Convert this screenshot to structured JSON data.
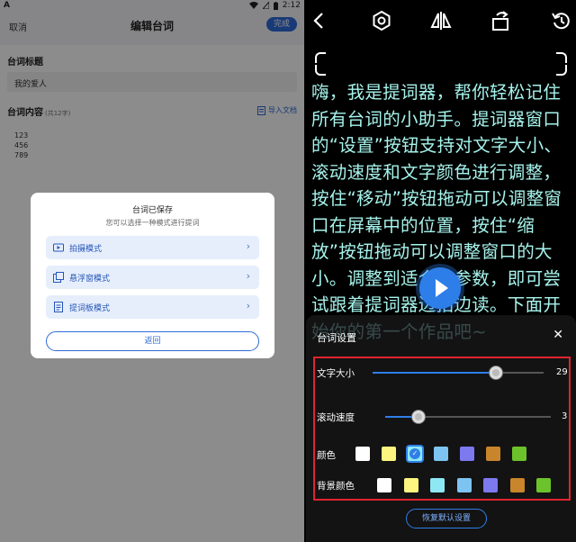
{
  "left": {
    "status": {
      "app_glyph": "A",
      "time": "2:12"
    },
    "header": {
      "cancel": "取消",
      "title": "编辑台词",
      "done": "完成"
    },
    "form": {
      "title_label": "台词标题",
      "title_value": "我的爱人",
      "content_label": "台词内容",
      "content_count": "(共12字)",
      "import_label": "导入文档",
      "content_lines": [
        "123",
        "456",
        "789"
      ]
    },
    "dialog": {
      "title": "台词已保存",
      "subtitle": "您可以选择一种模式进行提词",
      "modes": [
        {
          "label": "拍摄模式",
          "icon": "video-icon"
        },
        {
          "label": "悬浮窗模式",
          "icon": "floating-window-icon"
        },
        {
          "label": "提词板模式",
          "icon": "document-icon"
        }
      ],
      "back": "返回"
    }
  },
  "right": {
    "toolbar": [
      "back-arrow-icon",
      "settings-hex-icon",
      "mirror-icon",
      "rotate-icon",
      "reset-icon"
    ],
    "prompt_text": "嗨，我是提词器，帮你轻松记住所有台词的小助手。提词器窗口的“设置”按钮支持对文字大小、滚动速度和文字颜色进行调整，按住“移动”按钮拖动可以调整窗口在屏幕中的位置，按住“缩放”按钮拖动可以调整窗口的大小。调整到适合的参数，即可尝试跟着提词器边拍边读。下面开始你的第一个作品吧~",
    "settings": {
      "title": "台词设置",
      "font_size_label": "文字大小",
      "font_size_value": "29",
      "font_size_level": 0.72,
      "scroll_speed_label": "滚动速度",
      "scroll_speed_value": "3",
      "scroll_speed_level": 0.2,
      "color_label": "颜色",
      "bg_color_label": "背景颜色",
      "text_colors": [
        "#ffffff",
        "#fcf57f",
        "#8de8f4",
        "#7ec4f2",
        "#7d79ee",
        "#c8852b",
        "#6cc22a"
      ],
      "text_color_selected": 2,
      "bg_colors": [
        "#ffffff",
        "#fcf57f",
        "#8de8f4",
        "#7ec4f2",
        "#7d79ee",
        "#c8852b",
        "#6cc22a"
      ],
      "reset": "恢复默认设置"
    }
  }
}
